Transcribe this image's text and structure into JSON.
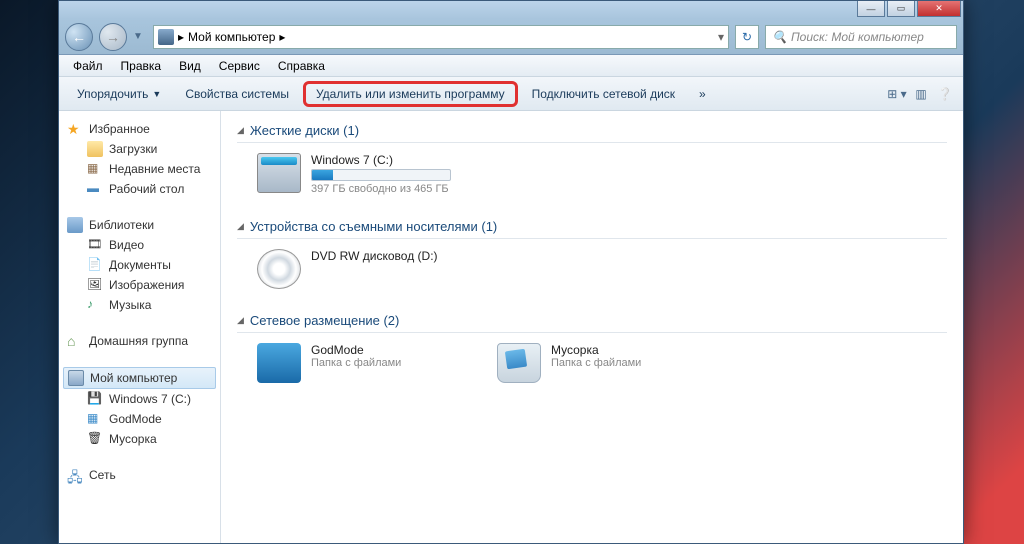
{
  "titlebar": {
    "min": "—",
    "max": "▭",
    "close": "✕"
  },
  "nav": {
    "back": "←",
    "forward": "→",
    "breadcrumb_root": "Мой компьютер",
    "refresh": "↻",
    "search_placeholder": "Поиск: Мой компьютер"
  },
  "menubar": [
    "Файл",
    "Правка",
    "Вид",
    "Сервис",
    "Справка"
  ],
  "toolbar": {
    "organize": "Упорядочить",
    "sysprops": "Свойства системы",
    "uninstall": "Удалить или изменить программу",
    "mapdrive": "Подключить сетевой диск",
    "more": "»"
  },
  "sidebar": {
    "favorites": {
      "label": "Избранное",
      "items": [
        "Загрузки",
        "Недавние места",
        "Рабочий стол"
      ]
    },
    "libraries": {
      "label": "Библиотеки",
      "items": [
        "Видео",
        "Документы",
        "Изображения",
        "Музыка"
      ]
    },
    "homegroup": {
      "label": "Домашняя группа"
    },
    "computer": {
      "label": "Мой компьютер",
      "items": [
        "Windows 7 (C:)",
        "GodMode",
        "Мусорка"
      ]
    },
    "network": {
      "label": "Сеть"
    }
  },
  "sections": {
    "hdd": {
      "title": "Жесткие диски (1)",
      "drive": {
        "name": "Windows 7 (C:)",
        "stat": "397 ГБ свободно из 465 ГБ",
        "fill_pct": 15
      }
    },
    "removable": {
      "title": "Устройства со съемными носителями (1)",
      "drive": {
        "name": "DVD RW дисковод (D:)"
      }
    },
    "network": {
      "title": "Сетевое размещение (2)",
      "items": [
        {
          "name": "GodMode",
          "type": "Папка с файлами"
        },
        {
          "name": "Мусорка",
          "type": "Папка с файлами"
        }
      ]
    }
  }
}
